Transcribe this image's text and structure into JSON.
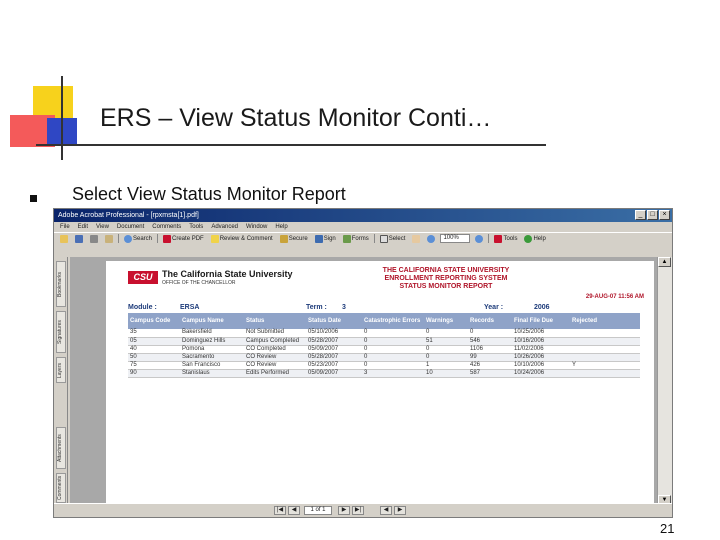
{
  "slide": {
    "title": "ERS – View Status Monitor Conti…",
    "bullet": "Select View Status Monitor Report",
    "page_number": "21"
  },
  "acrobat": {
    "title": "Adobe Acrobat Professional - [rpxmsta[1].pdf]",
    "window_controls": [
      "_",
      "□",
      "×"
    ],
    "menu": [
      "File",
      "Edit",
      "View",
      "Document",
      "Comments",
      "Tools",
      "Advanced",
      "Window",
      "Help"
    ],
    "toolbar": {
      "select_label": "Select",
      "search_label": "Search",
      "zoom_value": "100%",
      "create_pdf_label": "Create PDF",
      "review_label": "Review & Comment",
      "secure_label": "Secure",
      "sign_label": "Sign",
      "forms_label": "Forms",
      "tools_label": "Tools",
      "help_label": "Help"
    },
    "left_tabs": [
      "Bookmarks",
      "Signatures",
      "Layers",
      "Attachments",
      "Comments"
    ],
    "status": {
      "page_value": "1 of 1"
    }
  },
  "report": {
    "csu_logo": "CSU",
    "csu_name": "The California State University",
    "csu_sub": "OFFICE OF THE CHANCELLOR",
    "title_lines": [
      "THE CALIFORNIA STATE UNIVERSITY",
      "ENROLLMENT REPORTING SYSTEM",
      "STATUS MONITOR REPORT"
    ],
    "date": "29-AUG-07 11:56 AM",
    "module_label": "Module :",
    "module_value": "ERSA",
    "term_label": "Term :",
    "term_value": "3",
    "year_label": "Year :",
    "year_value": "2006",
    "columns": [
      "Campus Code",
      "Campus Name",
      "Status",
      "Status Date",
      "Catastrophic Errors",
      "Warnings",
      "Records",
      "Final File Due",
      "Rejected"
    ],
    "rows": [
      [
        "35",
        "Bakersfield",
        "Not Submitted",
        "05/10/2006",
        "0",
        "0",
        "0",
        "10/25/2006",
        ""
      ],
      [
        "05",
        "Dominguez Hills",
        "Campus Completed",
        "05/28/2007",
        "0",
        "51",
        "546",
        "10/16/2006",
        ""
      ],
      [
        "40",
        "Pomona",
        "CO Completed",
        "05/09/2007",
        "0",
        "0",
        "1106",
        "11/02/2006",
        ""
      ],
      [
        "50",
        "Sacramento",
        "CO Review",
        "05/28/2007",
        "0",
        "0",
        "99",
        "10/26/2006",
        ""
      ],
      [
        "75",
        "San Francisco",
        "CO Review",
        "05/23/2007",
        "0",
        "1",
        "426",
        "10/10/2006",
        "Y"
      ],
      [
        "90",
        "Stanislaus",
        "Edits Performed",
        "05/09/2007",
        "3",
        "10",
        "587",
        "10/24/2006",
        ""
      ]
    ]
  }
}
